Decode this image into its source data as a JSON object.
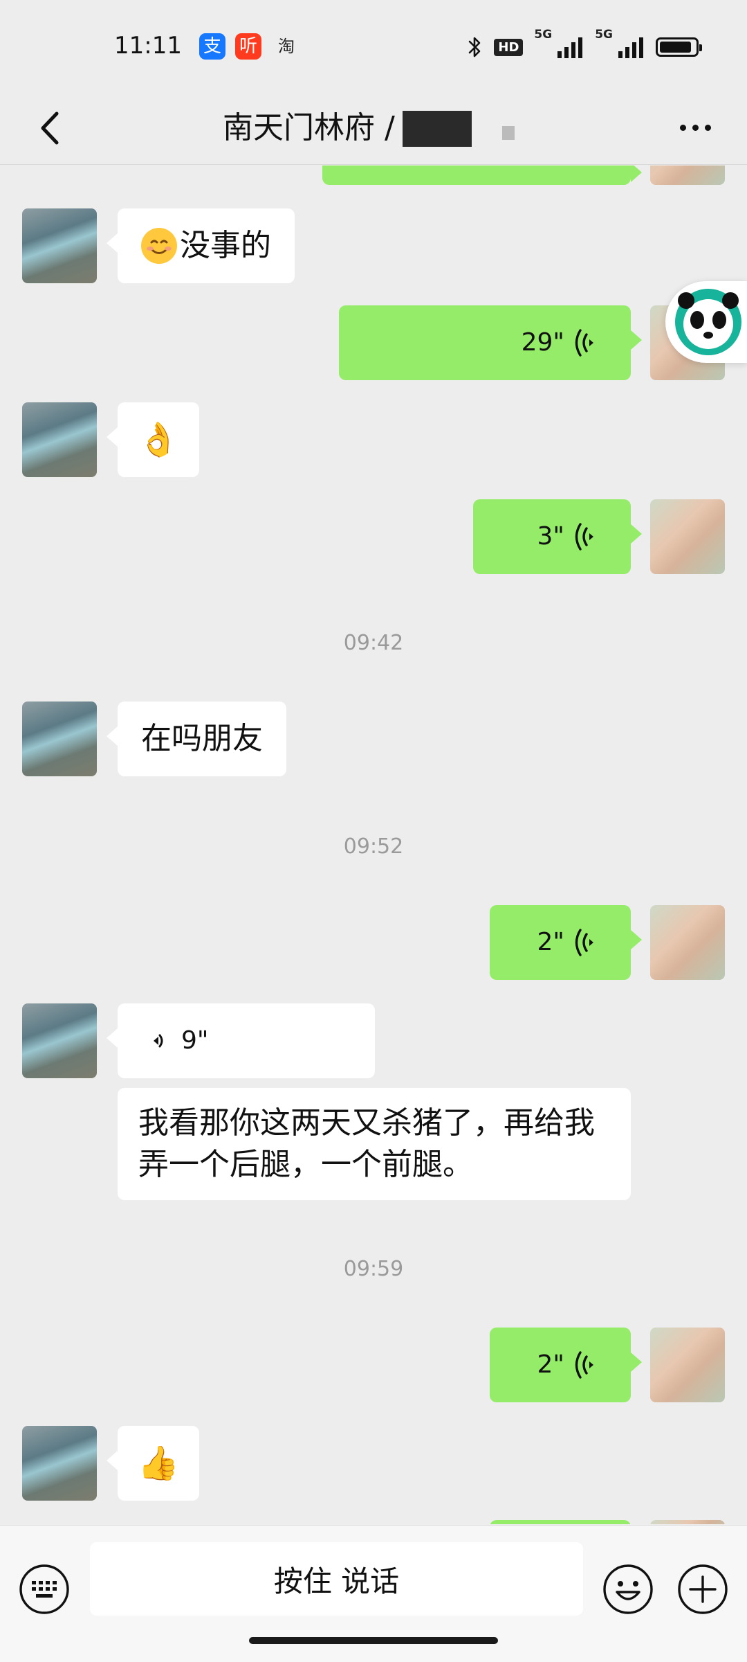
{
  "status_bar": {
    "time": "11:11",
    "app_icons": [
      "支",
      "听",
      "淘"
    ],
    "hd_label": "HD",
    "signal_labels": [
      "5G",
      "5G"
    ],
    "battery_level": 0.9
  },
  "header": {
    "title": "南天门林府 /"
  },
  "messages": {
    "m1_text": "没事的",
    "m2_duration": "29\"",
    "m3_emoji": "👌",
    "m4_duration": "3\"",
    "t1": "09:42",
    "m5_text": "在吗朋友",
    "t2": "09:52",
    "m6_duration": "2\"",
    "m7_duration": "9\"",
    "m8_text": "我看那你这两天又杀猪了，再给我弄一个后腿，一个前腿。",
    "t3": "09:59",
    "m9_duration": "2\"",
    "m10_emoji": "👍"
  },
  "input_bar": {
    "hold_to_talk": "按住 说话"
  },
  "colors": {
    "out_bubble": "#95ec69",
    "in_bubble": "#ffffff",
    "background": "#ededed"
  }
}
